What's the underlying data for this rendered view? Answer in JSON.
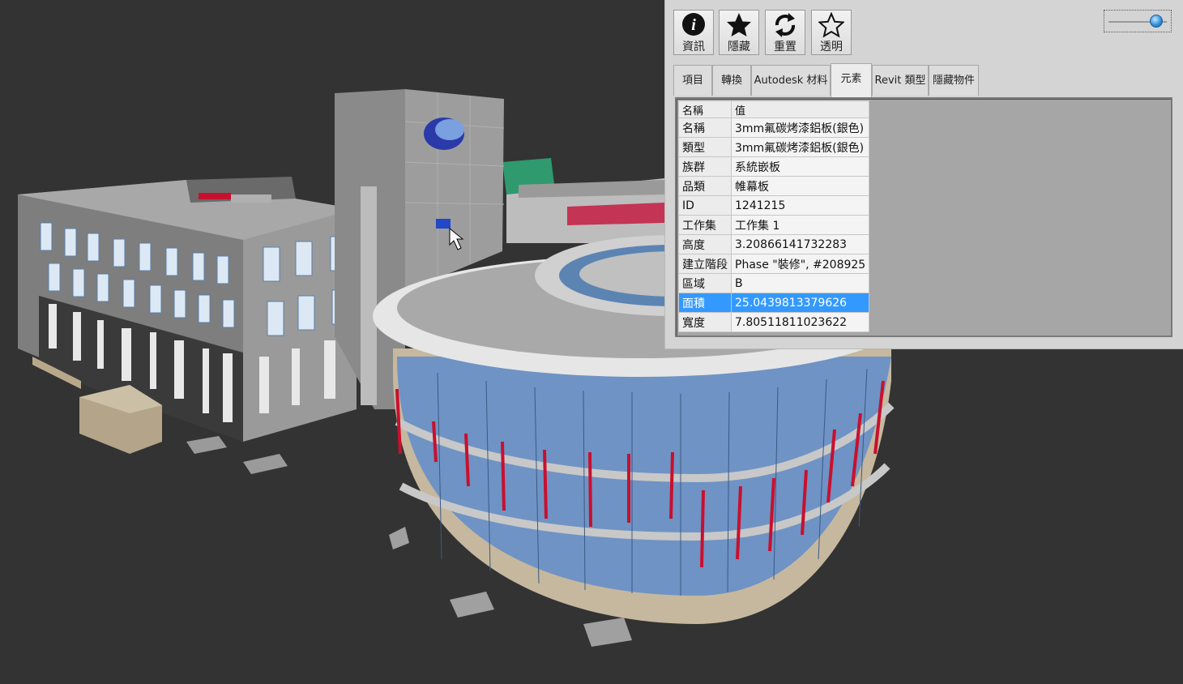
{
  "toolbar": {
    "buttons": [
      {
        "id": "info",
        "label": "資訊",
        "icon": "info-icon"
      },
      {
        "id": "hide",
        "label": "隱藏",
        "icon": "star-filled-icon"
      },
      {
        "id": "reset",
        "label": "重置",
        "icon": "reset-arrows-icon"
      },
      {
        "id": "transparent",
        "label": "透明",
        "icon": "star-outline-icon"
      }
    ],
    "opacity_slider": {
      "value": 0.85,
      "accent": "#2a8ad6"
    }
  },
  "tabs": [
    {
      "label": "項目",
      "active": false
    },
    {
      "label": "轉換",
      "active": false
    },
    {
      "label": "Autodesk 材料",
      "active": false
    },
    {
      "label": "元素",
      "active": true
    },
    {
      "label": "Revit 類型",
      "active": false
    },
    {
      "label": "隱藏物件",
      "active": false
    }
  ],
  "properties": {
    "headers": {
      "name": "名稱",
      "value": "值"
    },
    "rows": [
      {
        "key": "名稱",
        "value": "3mm氟碳烤漆鋁板(銀色)",
        "selected": false
      },
      {
        "key": "類型",
        "value": "3mm氟碳烤漆鋁板(銀色)",
        "selected": false
      },
      {
        "key": "族群",
        "value": "系統嵌板",
        "selected": false
      },
      {
        "key": "品類",
        "value": "帷幕板",
        "selected": false
      },
      {
        "key": "ID",
        "value": "1241215",
        "selected": false
      },
      {
        "key": "工作集",
        "value": "工作集 1",
        "selected": false
      },
      {
        "key": "高度",
        "value": "3.20866141732283",
        "selected": false
      },
      {
        "key": "建立階段",
        "value": "Phase \"裝修\", #208925",
        "selected": false
      },
      {
        "key": "區域",
        "value": "B",
        "selected": false
      },
      {
        "key": "面積",
        "value": "25.0439813379626",
        "selected": true
      },
      {
        "key": "寬度",
        "value": "7.80511811023622",
        "selected": false
      }
    ]
  },
  "colors": {
    "viewport_background": "#333333",
    "selection": "#3399ff",
    "accent_red": "#c8102e",
    "glass_blue": "#6f93c4"
  }
}
